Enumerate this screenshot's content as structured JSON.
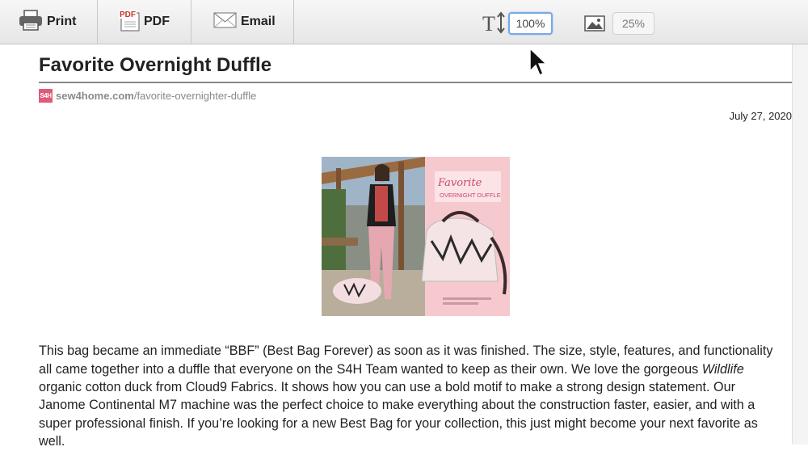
{
  "toolbar": {
    "print_label": "Print",
    "pdf_label": "PDF",
    "email_label": "Email",
    "text_size_value": "100%",
    "image_size_value": "25%",
    "icons": [
      "printer-icon",
      "pdf-icon",
      "envelope-icon",
      "text-size-icon",
      "image-icon"
    ]
  },
  "article": {
    "title": "Favorite Overnight Duffle",
    "source_logo": "S4H",
    "source_domain": "sew4home.com",
    "source_path": "/favorite-overnighter-duffle",
    "date": "July 27, 2020",
    "image_title_line1": "Favorite",
    "image_title_line2": "OVERNIGHT DUFFLE",
    "body_before_italic": "This bag became an immediate “BBF” (Best Bag Forever) as soon as it was finished. The size, style, features, and functionality all came together into a duffle that everyone on the S4H Team wanted to keep as their own. We love the gorgeous ",
    "body_italic": "Wildlife",
    "body_after_italic": " organic cotton duck from Cloud9 Fabrics. It shows how you can use a bold motif to make a strong design statement. Our Janome Continental M7 machine was the perfect choice to make everything about the construction faster, easier, and with a super professional finish. If you’re looking for a new Best Bag for your collection, this just might become your next favorite as well."
  },
  "colors": {
    "accent_focus": "#7aa7e8",
    "source_logo_bg": "#e05a7a",
    "image_pink": "#f6c9cf"
  }
}
